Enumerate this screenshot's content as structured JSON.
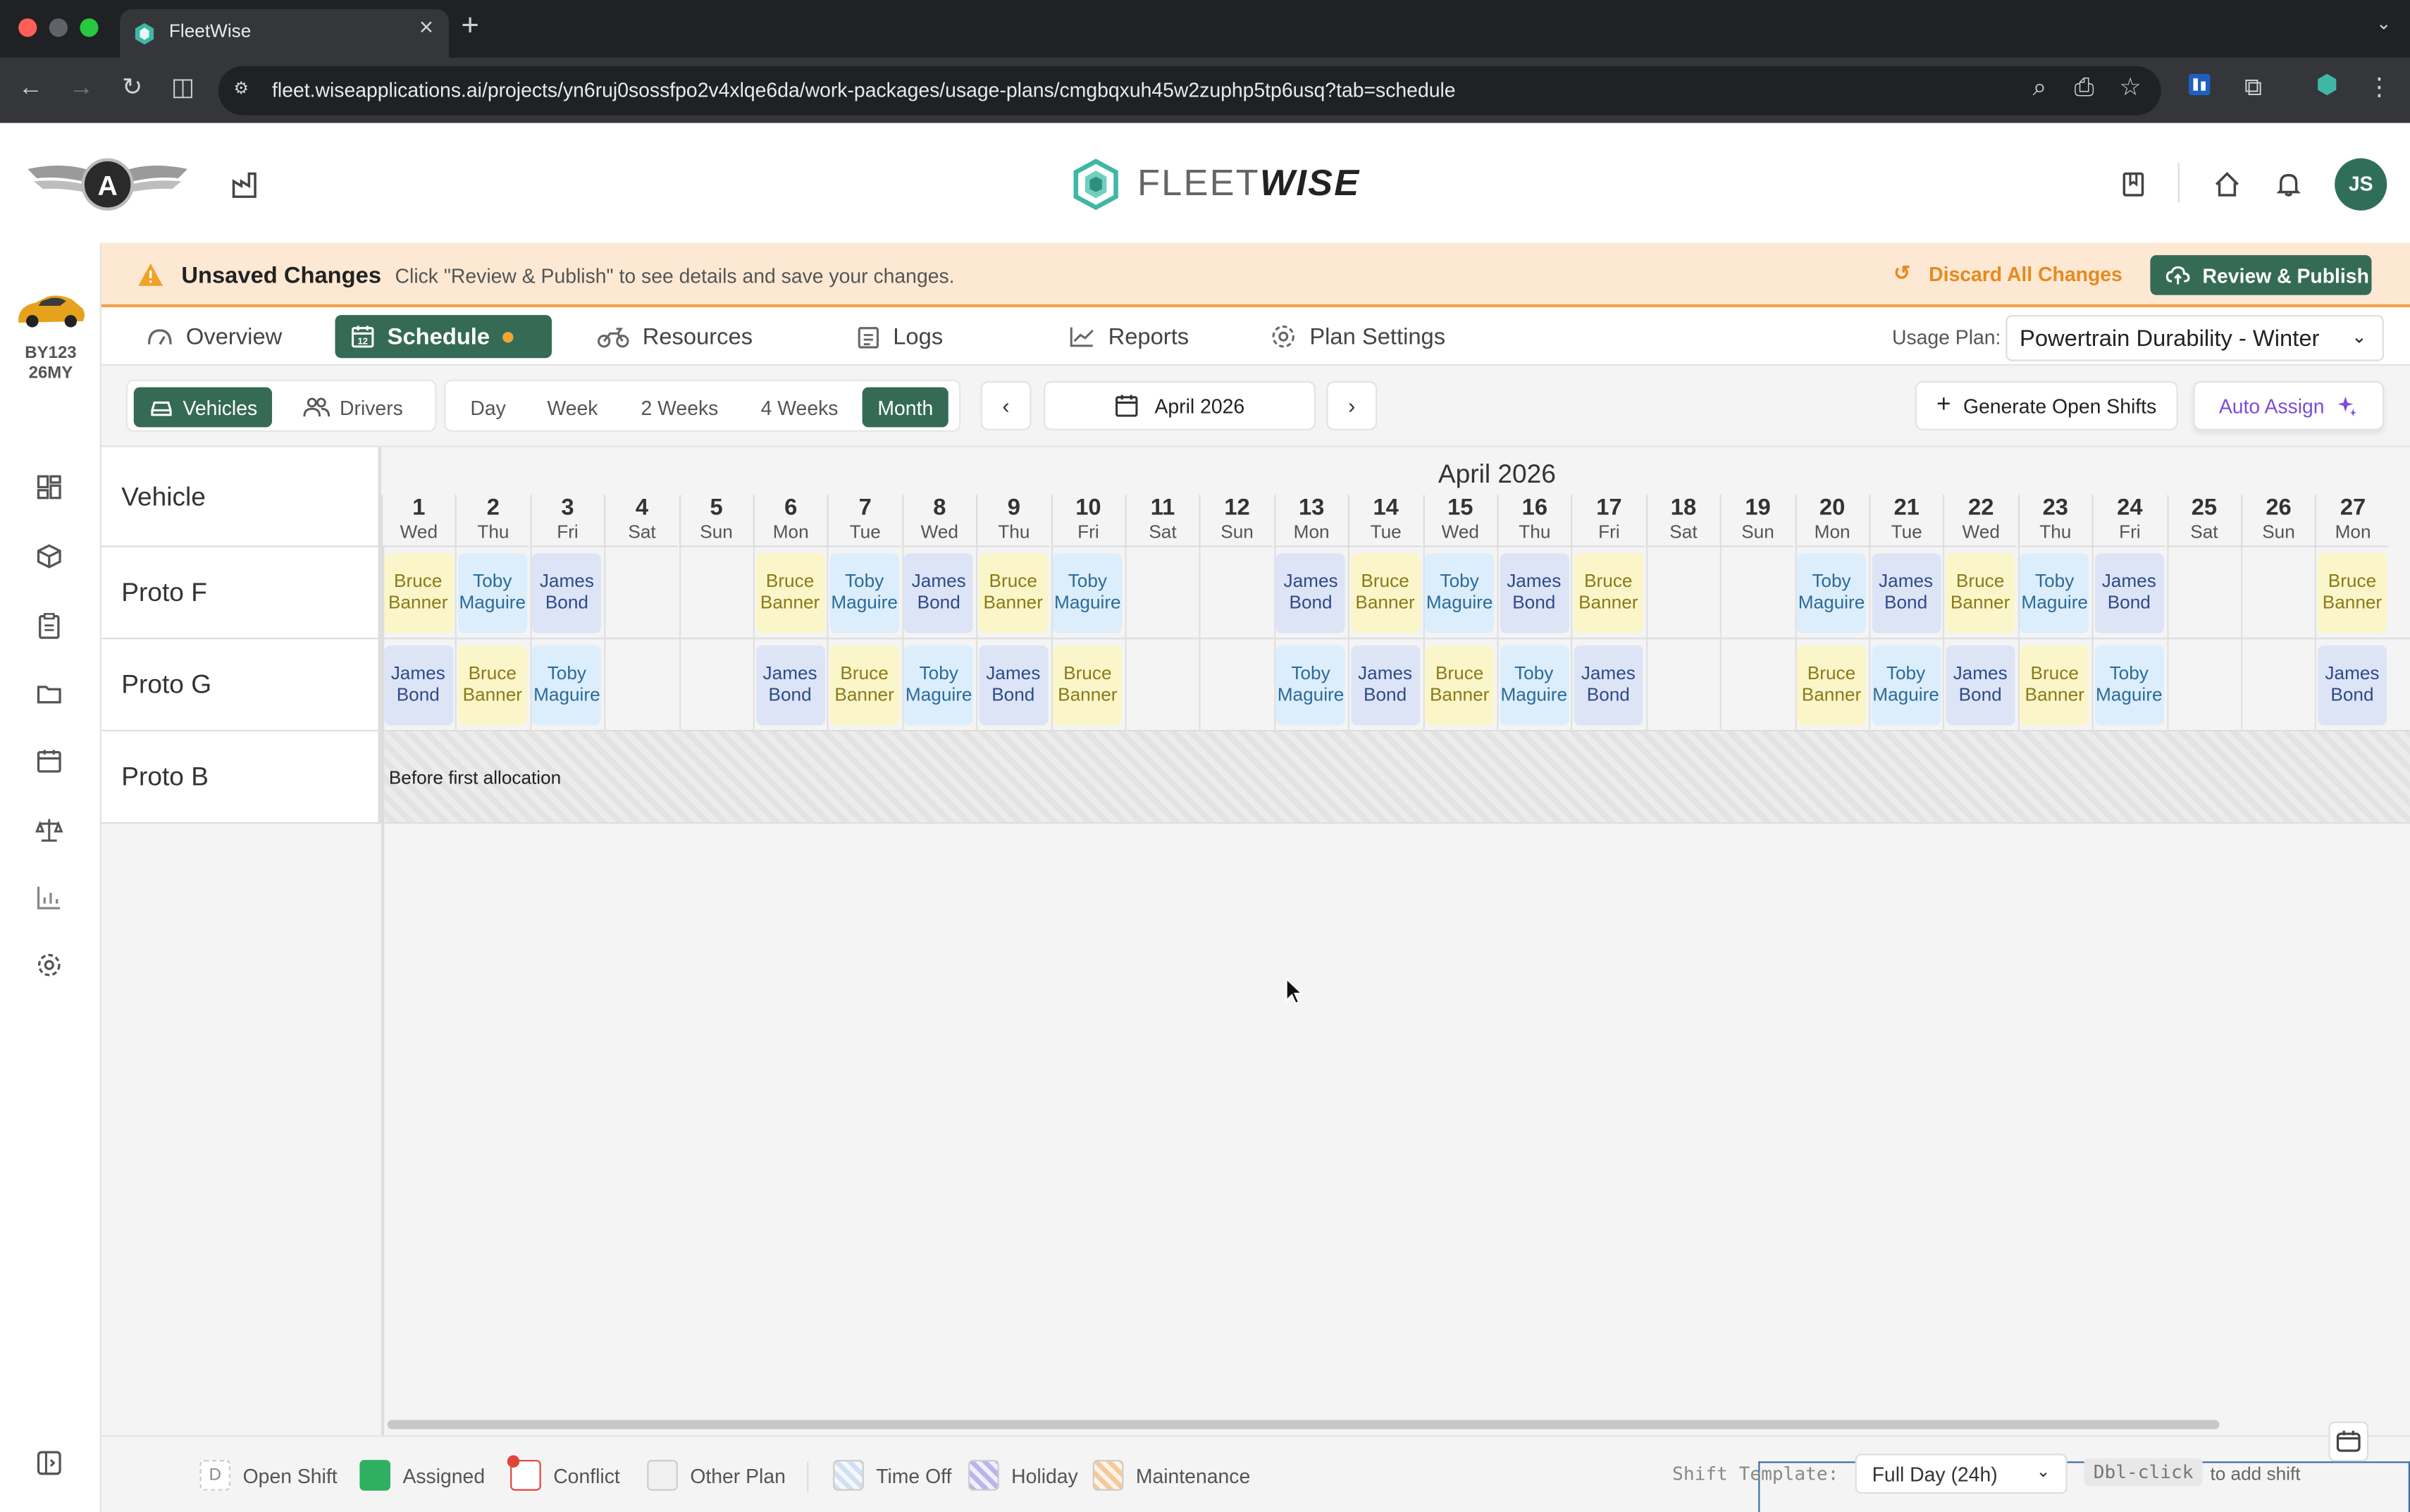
{
  "browser": {
    "tab_title": "FleetWise",
    "url": "fleet.wiseapplications.ai/projects/yn6ruj0sossfpo2v4xlqe6da/work-packages/usage-plans/cmgbqxuh45w2zuphp5tp6usq?tab=schedule"
  },
  "header": {
    "brand_light": "FLEET",
    "brand_bold": "WISE",
    "avatar_initials": "JS"
  },
  "sidebar": {
    "vehicle_id_line1": "BY123",
    "vehicle_id_line2": "26MY"
  },
  "banner": {
    "title": "Unsaved Changes",
    "message": "Click \"Review & Publish\" to see details and save your changes.",
    "discard_label": "Discard All Changes",
    "publish_label": "Review & Publish"
  },
  "tabs": {
    "overview": "Overview",
    "schedule": "Schedule",
    "resources": "Resources",
    "logs": "Logs",
    "reports": "Reports",
    "plan_settings": "Plan Settings"
  },
  "usage_plan": {
    "label": "Usage Plan:",
    "value": "Powertrain Durability - Winter"
  },
  "controls": {
    "vehicles": "Vehicles",
    "drivers": "Drivers",
    "day": "Day",
    "week": "Week",
    "two_weeks": "2 Weeks",
    "four_weeks": "4 Weeks",
    "month": "Month",
    "current_period": "April 2026",
    "generate_label": "Generate Open Shifts",
    "auto_assign_label": "Auto Assign"
  },
  "schedule": {
    "vehicle_column": "Vehicle",
    "month_title": "April 2026",
    "days": [
      {
        "n": "1",
        "w": "Wed"
      },
      {
        "n": "2",
        "w": "Thu"
      },
      {
        "n": "3",
        "w": "Fri"
      },
      {
        "n": "4",
        "w": "Sat"
      },
      {
        "n": "5",
        "w": "Sun"
      },
      {
        "n": "6",
        "w": "Mon"
      },
      {
        "n": "7",
        "w": "Tue"
      },
      {
        "n": "8",
        "w": "Wed"
      },
      {
        "n": "9",
        "w": "Thu"
      },
      {
        "n": "10",
        "w": "Fri"
      },
      {
        "n": "11",
        "w": "Sat"
      },
      {
        "n": "12",
        "w": "Sun"
      },
      {
        "n": "13",
        "w": "Mon"
      },
      {
        "n": "14",
        "w": "Tue"
      },
      {
        "n": "15",
        "w": "Wed"
      },
      {
        "n": "16",
        "w": "Thu"
      },
      {
        "n": "17",
        "w": "Fri"
      },
      {
        "n": "18",
        "w": "Sat"
      },
      {
        "n": "19",
        "w": "Sun"
      },
      {
        "n": "20",
        "w": "Mon"
      },
      {
        "n": "21",
        "w": "Tue"
      },
      {
        "n": "22",
        "w": "Wed"
      },
      {
        "n": "23",
        "w": "Thu"
      },
      {
        "n": "24",
        "w": "Fri"
      },
      {
        "n": "25",
        "w": "Sat"
      },
      {
        "n": "26",
        "w": "Sun"
      },
      {
        "n": "27",
        "w": "Mon"
      }
    ],
    "drivers": {
      "bb": [
        "Bruce",
        "Banner"
      ],
      "tm": [
        "Toby",
        "Maguire"
      ],
      "jb": [
        "James",
        "Bond"
      ]
    },
    "rows": [
      {
        "vehicle": "Proto F",
        "shifts": [
          "bb",
          "tm",
          "jb",
          "",
          "",
          "bb",
          "tm",
          "jb",
          "bb",
          "tm",
          "",
          "",
          "jb",
          "bb",
          "tm",
          "jb",
          "bb",
          "",
          "",
          "tm",
          "jb",
          "bb",
          "tm",
          "jb",
          "",
          "",
          "bb"
        ]
      },
      {
        "vehicle": "Proto G",
        "shifts": [
          "jb",
          "bb",
          "tm",
          "",
          "",
          "jb",
          "bb",
          "tm",
          "jb",
          "bb",
          "",
          "",
          "tm",
          "jb",
          "bb",
          "tm",
          "jb",
          "",
          "",
          "bb",
          "tm",
          "jb",
          "bb",
          "tm",
          "",
          "",
          "jb"
        ]
      }
    ],
    "proto_b": {
      "vehicle": "Proto B",
      "note": "Before first allocation"
    }
  },
  "legend": {
    "open_shift_key": "D",
    "open_shift": "Open Shift",
    "assigned": "Assigned",
    "conflict": "Conflict",
    "other_plan": "Other Plan",
    "time_off": "Time Off",
    "holiday": "Holiday",
    "maintenance": "Maintenance",
    "template_label": "Shift Template:",
    "template_value": "Full Day (24h)",
    "dbl_click": "Dbl-click",
    "dbl_hint": "to add shift"
  },
  "colors": {
    "accent": "#356b55",
    "warning": "#f2a24a",
    "bruce_banner": "#fbf6c9",
    "toby_maguire": "#dceefb",
    "james_bond": "#dde4f6"
  }
}
